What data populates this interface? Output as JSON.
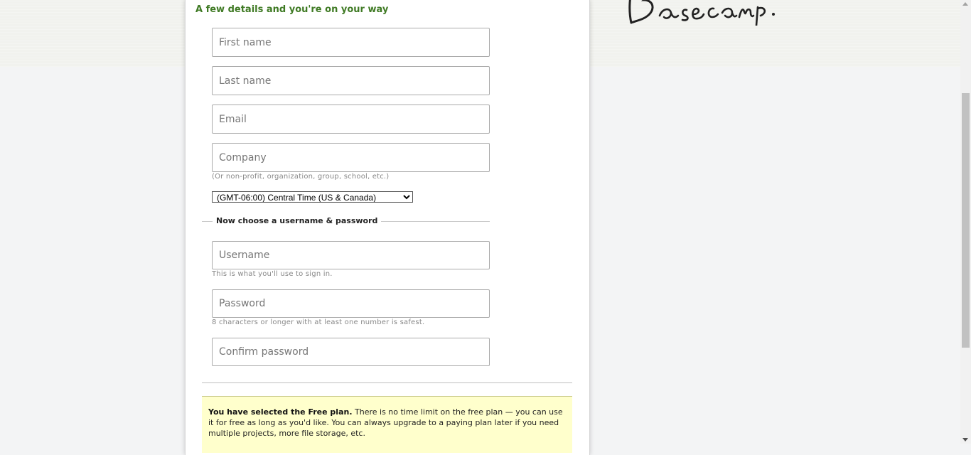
{
  "form": {
    "heading": "A few details and you're on your way",
    "first_name_placeholder": "First name",
    "last_name_placeholder": "Last name",
    "email_placeholder": "Email",
    "company_placeholder": "Company",
    "company_hint": "(Or non-profit, organization, group, school, etc.)",
    "timezone_selected": "(GMT-06:00) Central Time (US & Canada)",
    "section_title": "Now choose a username & password",
    "username_placeholder": "Username",
    "username_hint": "This is what you'll use to sign in.",
    "password_placeholder": "Password",
    "password_hint": "8 characters or longer with at least one number is safest.",
    "confirm_placeholder": "Confirm password"
  },
  "notice": {
    "bold": "You have selected the Free plan.",
    "text": " There is no time limit on the free plan — you can use it for free as long as you'd like. You can always upgrade to a paying plan later if you need multiple projects, more file storage, etc."
  },
  "colors": {
    "heading_green": "#3f7a24",
    "notice_bg": "#ffffcc"
  },
  "icons": {
    "logo": "basecamp-logo"
  }
}
